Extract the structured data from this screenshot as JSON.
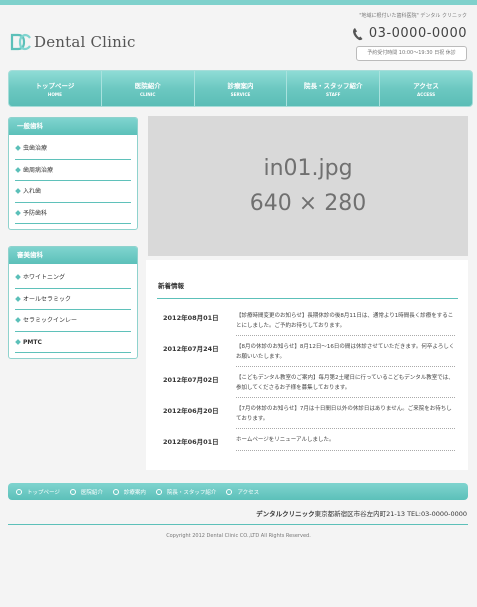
{
  "header": {
    "tagline": "\"地域に根付いた歯科医院\" デンタル クリニック",
    "logo_text": "Dental Clinic",
    "phone": "03-0000-0000",
    "hours": "予約受付時間 10:00～19:30 日祝 休診"
  },
  "nav": [
    {
      "jp": "トップページ",
      "en": "HOME"
    },
    {
      "jp": "医院紹介",
      "en": "CLINIC"
    },
    {
      "jp": "診療案内",
      "en": "SERVICE"
    },
    {
      "jp": "院長・スタッフ紹介",
      "en": "STAFF"
    },
    {
      "jp": "アクセス",
      "en": "ACCESS"
    }
  ],
  "sidebar": {
    "general": {
      "title": "一般歯科",
      "items": [
        "虫歯治療",
        "歯周病治療",
        "入れ歯",
        "予防歯科"
      ]
    },
    "cosmetic": {
      "title": "審美歯科",
      "items": [
        "ホワイトニング",
        "オールセラミック",
        "セラミックインレー",
        "PMTC"
      ]
    }
  },
  "main_image": {
    "line1": "in01.jpg",
    "line2": "640 × 280"
  },
  "news": {
    "title": "新着情報",
    "items": [
      {
        "date": "2012年08月01日",
        "text": "【診療時間変更のお知らせ】長期休診の後8月11日は、通常より1時間長く診療をすることにしました。ご予約お待ちしております。"
      },
      {
        "date": "2012年07月24日",
        "text": "【8月の休診のお知らせ】8月12日～16日の間は休診させていただきます。何卒よろしくお願いいたします。"
      },
      {
        "date": "2012年07月02日",
        "text": "【こどもデンタル教室のご案内】毎月第2土曜日に行っているこどもデンタル教室では、参加してくださるお子様を募集しております。"
      },
      {
        "date": "2012年06月20日",
        "text": "【7月の休診のお知らせ】7月は十日間日以外の休診日はありません。ご来院をお待ちしております。"
      },
      {
        "date": "2012年06月01日",
        "text": "ホームページをリニューアルしました。"
      }
    ]
  },
  "footer": {
    "nav": [
      "トップページ",
      "医院紹介",
      "診療案内",
      "院長・スタッフ紹介",
      "アクセス"
    ],
    "clinic_name": "デンタルクリニック",
    "address": "東京都新宿区市谷左内町21-13 TEL:03-0000-0000",
    "copyright": "Copyright 2012 Dental Clinic CO.,LTD All Rights Reserved."
  },
  "colors": {
    "accent": "#5cc0b9",
    "accent_light": "#7fd4cf",
    "background": "#f4f4f4"
  }
}
